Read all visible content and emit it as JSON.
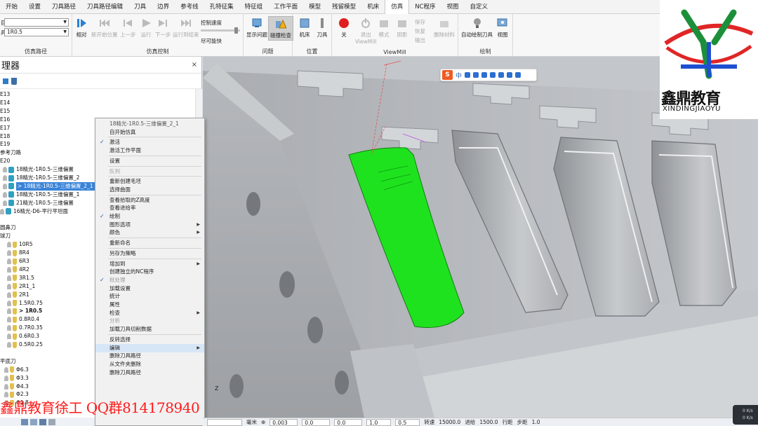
{
  "menubar": {
    "tabs": [
      "开始",
      "设置",
      "刀具路径",
      "刀具路径编辑",
      "刀具",
      "边界",
      "参考线",
      "孔特征集",
      "特征组",
      "工作平面",
      "模型",
      "残留模型",
      "机床",
      "仿真",
      "NC程序",
      "视图",
      "自定义"
    ],
    "active_tab": "仿真"
  },
  "ribbon": {
    "sim_path": {
      "group_label": "仿真路径",
      "label_a": "目",
      "label_b": "具",
      "combo_b_value": "1R0.5"
    },
    "sim_control": {
      "group_label": "仿真控制",
      "relative": "相对",
      "new_tool_pos": "新开始位置",
      "prev_step": "上一步",
      "run": "运行",
      "next_step": "下一步",
      "run_to_end": "运行到结束",
      "speed_label": "控制速度",
      "fast_label": "尽可能快"
    },
    "issues": {
      "group_label": "问题",
      "show_issues": "显示问题",
      "collision_check": "碰撞检查"
    },
    "position": {
      "group_label": "位置",
      "machine": "机床",
      "tool": "刀具"
    },
    "viewmill": {
      "group_label": "ViewMill",
      "off": "关",
      "exit": "退出",
      "exit2": "ViewMill",
      "mode": "模式",
      "shading": "阴影",
      "save": "保存",
      "restore": "恢复",
      "output": "输出",
      "remove_material": "删除材料"
    },
    "draw": {
      "group_label": "绘制",
      "auto_draw_tool": "自动绘制刀具",
      "view": "视图"
    }
  },
  "explorer": {
    "title": "理器",
    "close": "×",
    "tree": [
      {
        "text": "E13",
        "kind": "text",
        "indent": 0
      },
      {
        "text": "E14",
        "kind": "text",
        "indent": 0
      },
      {
        "text": "E15",
        "kind": "text",
        "indent": 0
      },
      {
        "text": "E16",
        "kind": "text",
        "indent": 0
      },
      {
        "text": "E17",
        "kind": "text",
        "indent": 0
      },
      {
        "text": "E18",
        "kind": "text",
        "indent": 0
      },
      {
        "text": "E19",
        "kind": "text",
        "indent": 0
      },
      {
        "text": "参考刀路",
        "kind": "text",
        "indent": 0
      },
      {
        "text": "E20",
        "kind": "text",
        "indent": 0
      },
      {
        "text": "18精光-1R0.5-三维偏置",
        "kind": "path",
        "indent": 1
      },
      {
        "text": "18精光-1R0.5-三维偏置_2",
        "kind": "path",
        "indent": 1
      },
      {
        "text": "> 18精光-1R0.5-三维偏置_2_1",
        "kind": "path",
        "indent": 1,
        "selected": true
      },
      {
        "text": "18精光-1R0.5-三维偏置_1",
        "kind": "path",
        "indent": 1
      },
      {
        "text": "21精光-1R0.5-三维偏置",
        "kind": "path",
        "indent": 1
      },
      {
        "text": "16精光-D6-平行平坦面",
        "kind": "path",
        "indent": 0
      },
      {
        "text": "",
        "kind": "text",
        "indent": 0
      },
      {
        "text": "圆鼻刀",
        "kind": "text",
        "indent": 0
      },
      {
        "text": "球刀",
        "kind": "text",
        "indent": 0
      },
      {
        "text": "10R5",
        "kind": "tool",
        "indent": 1
      },
      {
        "text": "8R4",
        "kind": "tool",
        "indent": 1
      },
      {
        "text": "6R3",
        "kind": "tool",
        "indent": 1
      },
      {
        "text": "4R2",
        "kind": "tool",
        "indent": 1
      },
      {
        "text": "3R1.5",
        "kind": "tool",
        "indent": 1
      },
      {
        "text": "2R1_1",
        "kind": "tool",
        "indent": 1
      },
      {
        "text": "2R1",
        "kind": "tool",
        "indent": 1
      },
      {
        "text": "1.5R0.75",
        "kind": "tool",
        "indent": 1
      },
      {
        "text": "> 1R0.5",
        "kind": "tool",
        "indent": 1,
        "bold": true
      },
      {
        "text": "0.8R0.4",
        "kind": "tool",
        "indent": 1
      },
      {
        "text": "0.7R0.35",
        "kind": "tool",
        "indent": 1
      },
      {
        "text": "0.6R0.3",
        "kind": "tool",
        "indent": 1
      },
      {
        "text": "0.5R0.25",
        "kind": "tool",
        "indent": 1
      },
      {
        "text": "",
        "kind": "text",
        "indent": 0
      },
      {
        "text": "平底刀",
        "kind": "text",
        "indent": 0
      },
      {
        "text": "Φ6.3",
        "kind": "tool",
        "indent": 0
      },
      {
        "text": "Φ3.3",
        "kind": "tool",
        "indent": 0
      },
      {
        "text": "Φ4.3",
        "kind": "tool",
        "indent": 0
      },
      {
        "text": "Φ2.3",
        "kind": "tool",
        "indent": 0
      },
      {
        "text": "Φ1.8",
        "kind": "tool",
        "indent": 0
      }
    ]
  },
  "context_menu": {
    "items": [
      {
        "label": "18精光-1R0.5-三维偏置_2_1",
        "type": "header"
      },
      {
        "label": "自开始仿真"
      },
      {
        "sep": true
      },
      {
        "label": "激活",
        "checked": true
      },
      {
        "label": "激活工作平面"
      },
      {
        "sep": true
      },
      {
        "label": "设置"
      },
      {
        "sep": true
      },
      {
        "label": "队列",
        "disabled": true
      },
      {
        "sep": true
      },
      {
        "label": "重新创建毛坯"
      },
      {
        "label": "选择曲面"
      },
      {
        "sep": true
      },
      {
        "label": "查看拾取的Z高度"
      },
      {
        "label": "查看进给率"
      },
      {
        "label": "绘制",
        "checked": true
      },
      {
        "label": "图形选项",
        "submenu": true
      },
      {
        "label": "颜色",
        "submenu": true
      },
      {
        "sep": true
      },
      {
        "label": "重新命名"
      },
      {
        "sep": true
      },
      {
        "label": "另存为策略"
      },
      {
        "sep": true
      },
      {
        "label": "增加到",
        "submenu": true
      },
      {
        "label": "创建独立的NC程序"
      },
      {
        "label": "批处理",
        "checked": true,
        "disabled": true
      },
      {
        "label": "加载设置"
      },
      {
        "label": "统计"
      },
      {
        "label": "属性"
      },
      {
        "label": "检查",
        "submenu": true
      },
      {
        "label": "分析",
        "disabled": true
      },
      {
        "label": "加载刀具切削数据"
      },
      {
        "sep": true
      },
      {
        "label": "反转选择"
      },
      {
        "label": "编辑",
        "submenu": true,
        "hover": true
      },
      {
        "label": "删除刀具路径"
      },
      {
        "label": "从文件夹删除"
      },
      {
        "label": "删除刀具路径"
      }
    ]
  },
  "statusbar": {
    "units": "毫米",
    "tolerance": "0.003",
    "thickness": "0.0",
    "axial": "0.0",
    "stepover": "1.0",
    "stepdown": "0.5",
    "spindle_label": "转速",
    "spindle": "15000.0",
    "feed_label": "进给",
    "feed": "1500.0",
    "row_label": "行距",
    "step_label": "步距",
    "step": "1.0"
  },
  "overlays": {
    "logo_text": "鑫鼎教育",
    "logo_pinyin": "XINDINGJIAOYU",
    "watermark": "鑫鼎教育徐工  QQ群814178940",
    "ime_logo": "S",
    "ime_mode": "中",
    "axis_label": "Z",
    "net_up": "0 K/s",
    "net_down": "0 K/s"
  },
  "colors": {
    "selection_green": "#1fe21f",
    "accent_blue": "#3a84d8",
    "watermark_red": "#ff1a1a"
  }
}
